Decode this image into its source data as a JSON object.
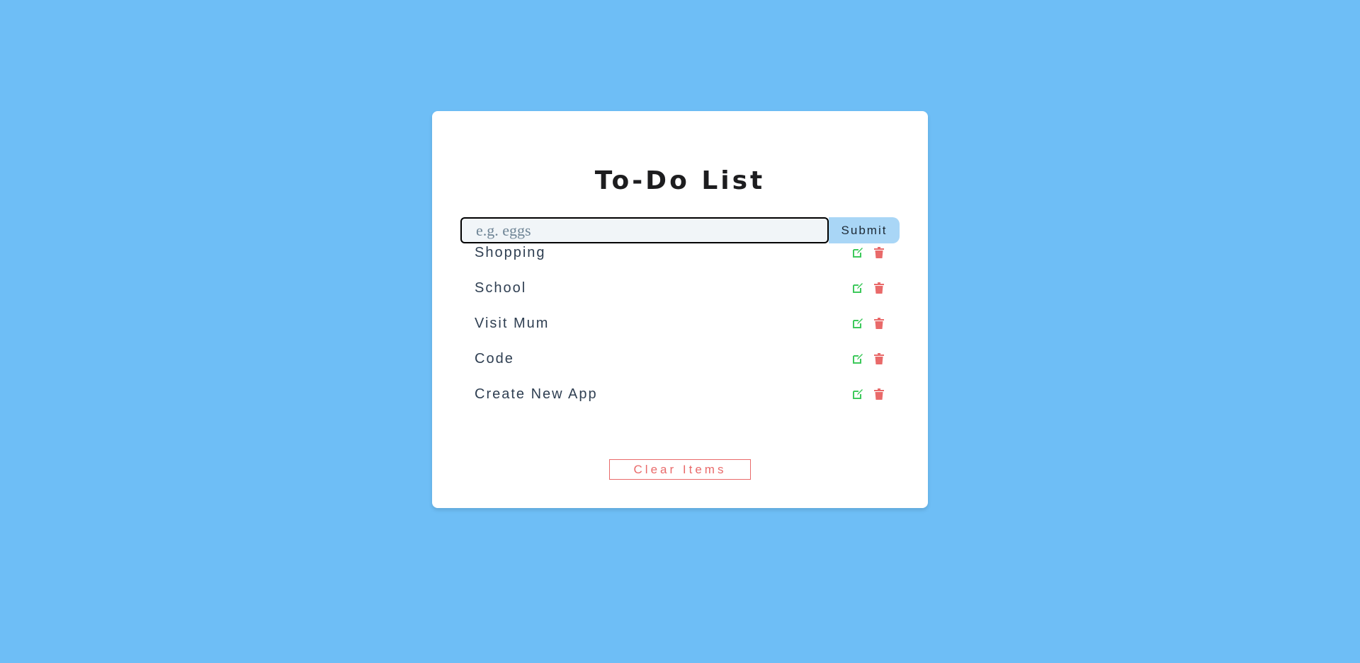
{
  "title": "To-Do List",
  "form": {
    "input_value": "",
    "input_placeholder": "e.g. eggs",
    "submit_label": "Submit"
  },
  "items": [
    {
      "label": "Shopping"
    },
    {
      "label": "School"
    },
    {
      "label": "Visit Mum"
    },
    {
      "label": "Code"
    },
    {
      "label": "Create New App"
    }
  ],
  "icons": {
    "edit": "edit-icon",
    "delete": "trash-icon"
  },
  "clear_label": "Clear Items",
  "colors": {
    "background": "#6ebef6",
    "card": "#ffffff",
    "edit": "#3ec95c",
    "delete": "#e96a6a",
    "submit": "#a9d6f6"
  }
}
